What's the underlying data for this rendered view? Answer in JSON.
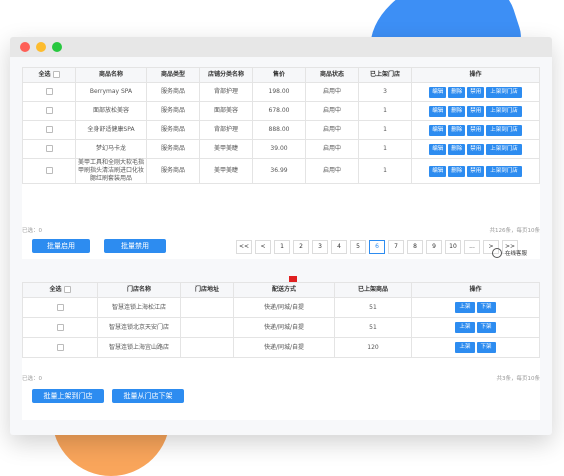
{
  "colors": {
    "accent": "#2d8cf0",
    "arrow": "#e02020",
    "blob_blue": "#3d8ff5",
    "blob_orange": "#f9a55b"
  },
  "table1": {
    "headers": [
      "全选",
      "商品名称",
      "商品类型",
      "店铺分类名称",
      "售价",
      "商品状态",
      "已上架门店",
      "操作"
    ],
    "rows": [
      {
        "name": "Berrymay SPA",
        "type": "服务商品",
        "category": "背部护理",
        "price": "198.00",
        "status": "启用中",
        "stores": "3"
      },
      {
        "name": "面部放松美容",
        "type": "服务商品",
        "category": "面部美容",
        "price": "678.00",
        "status": "启用中",
        "stores": "1"
      },
      {
        "name": "全身舒适健康SPA",
        "type": "服务商品",
        "category": "背部护理",
        "price": "888.00",
        "status": "启用中",
        "stores": "1"
      },
      {
        "name": "梦幻马卡龙",
        "type": "服务商品",
        "category": "美甲美睫",
        "price": "39.00",
        "status": "启用中",
        "stores": "1"
      },
      {
        "name": "美甲工具和全刚大软毛指甲刷指头清洁刷进口化妆腮红刷套装用品",
        "type": "服务商品",
        "category": "美甲美睫",
        "price": "36.99",
        "status": "启用中",
        "stores": "1"
      }
    ],
    "actions": [
      "编辑",
      "删除",
      "禁用",
      "上架到门店"
    ],
    "selected": "已选：0",
    "total": "共126条，每页10条",
    "batch_enable": "批量启用",
    "batch_disable": "批量禁用",
    "pager": [
      "<<",
      "<",
      "1",
      "2",
      "3",
      "4",
      "5",
      "6",
      "7",
      "8",
      "9",
      "10",
      "...",
      ">",
      ">>"
    ],
    "current_page": "6"
  },
  "service": {
    "label": "在线客服",
    "icon": "headset-icon"
  },
  "table2": {
    "headers": [
      "全选",
      "门店名称",
      "门店地址",
      "配送方式",
      "已上架商品",
      "操作"
    ],
    "rows": [
      {
        "name": "智慧连锁上海松江店",
        "address": "",
        "delivery": "快递/同城/自提",
        "count": "51"
      },
      {
        "name": "智慧连锁北京天安门店",
        "address": "",
        "delivery": "快递/同城/自提",
        "count": "51"
      },
      {
        "name": "智慧连锁上海宜山路店",
        "address": "",
        "delivery": "快递/同城/自提",
        "count": "120"
      }
    ],
    "actions": [
      "上架",
      "下架"
    ],
    "selected": "已选：0",
    "total": "共3条，每页10条",
    "batch_shelve": "批量上架到门店",
    "batch_unshelve": "批量从门店下架"
  }
}
